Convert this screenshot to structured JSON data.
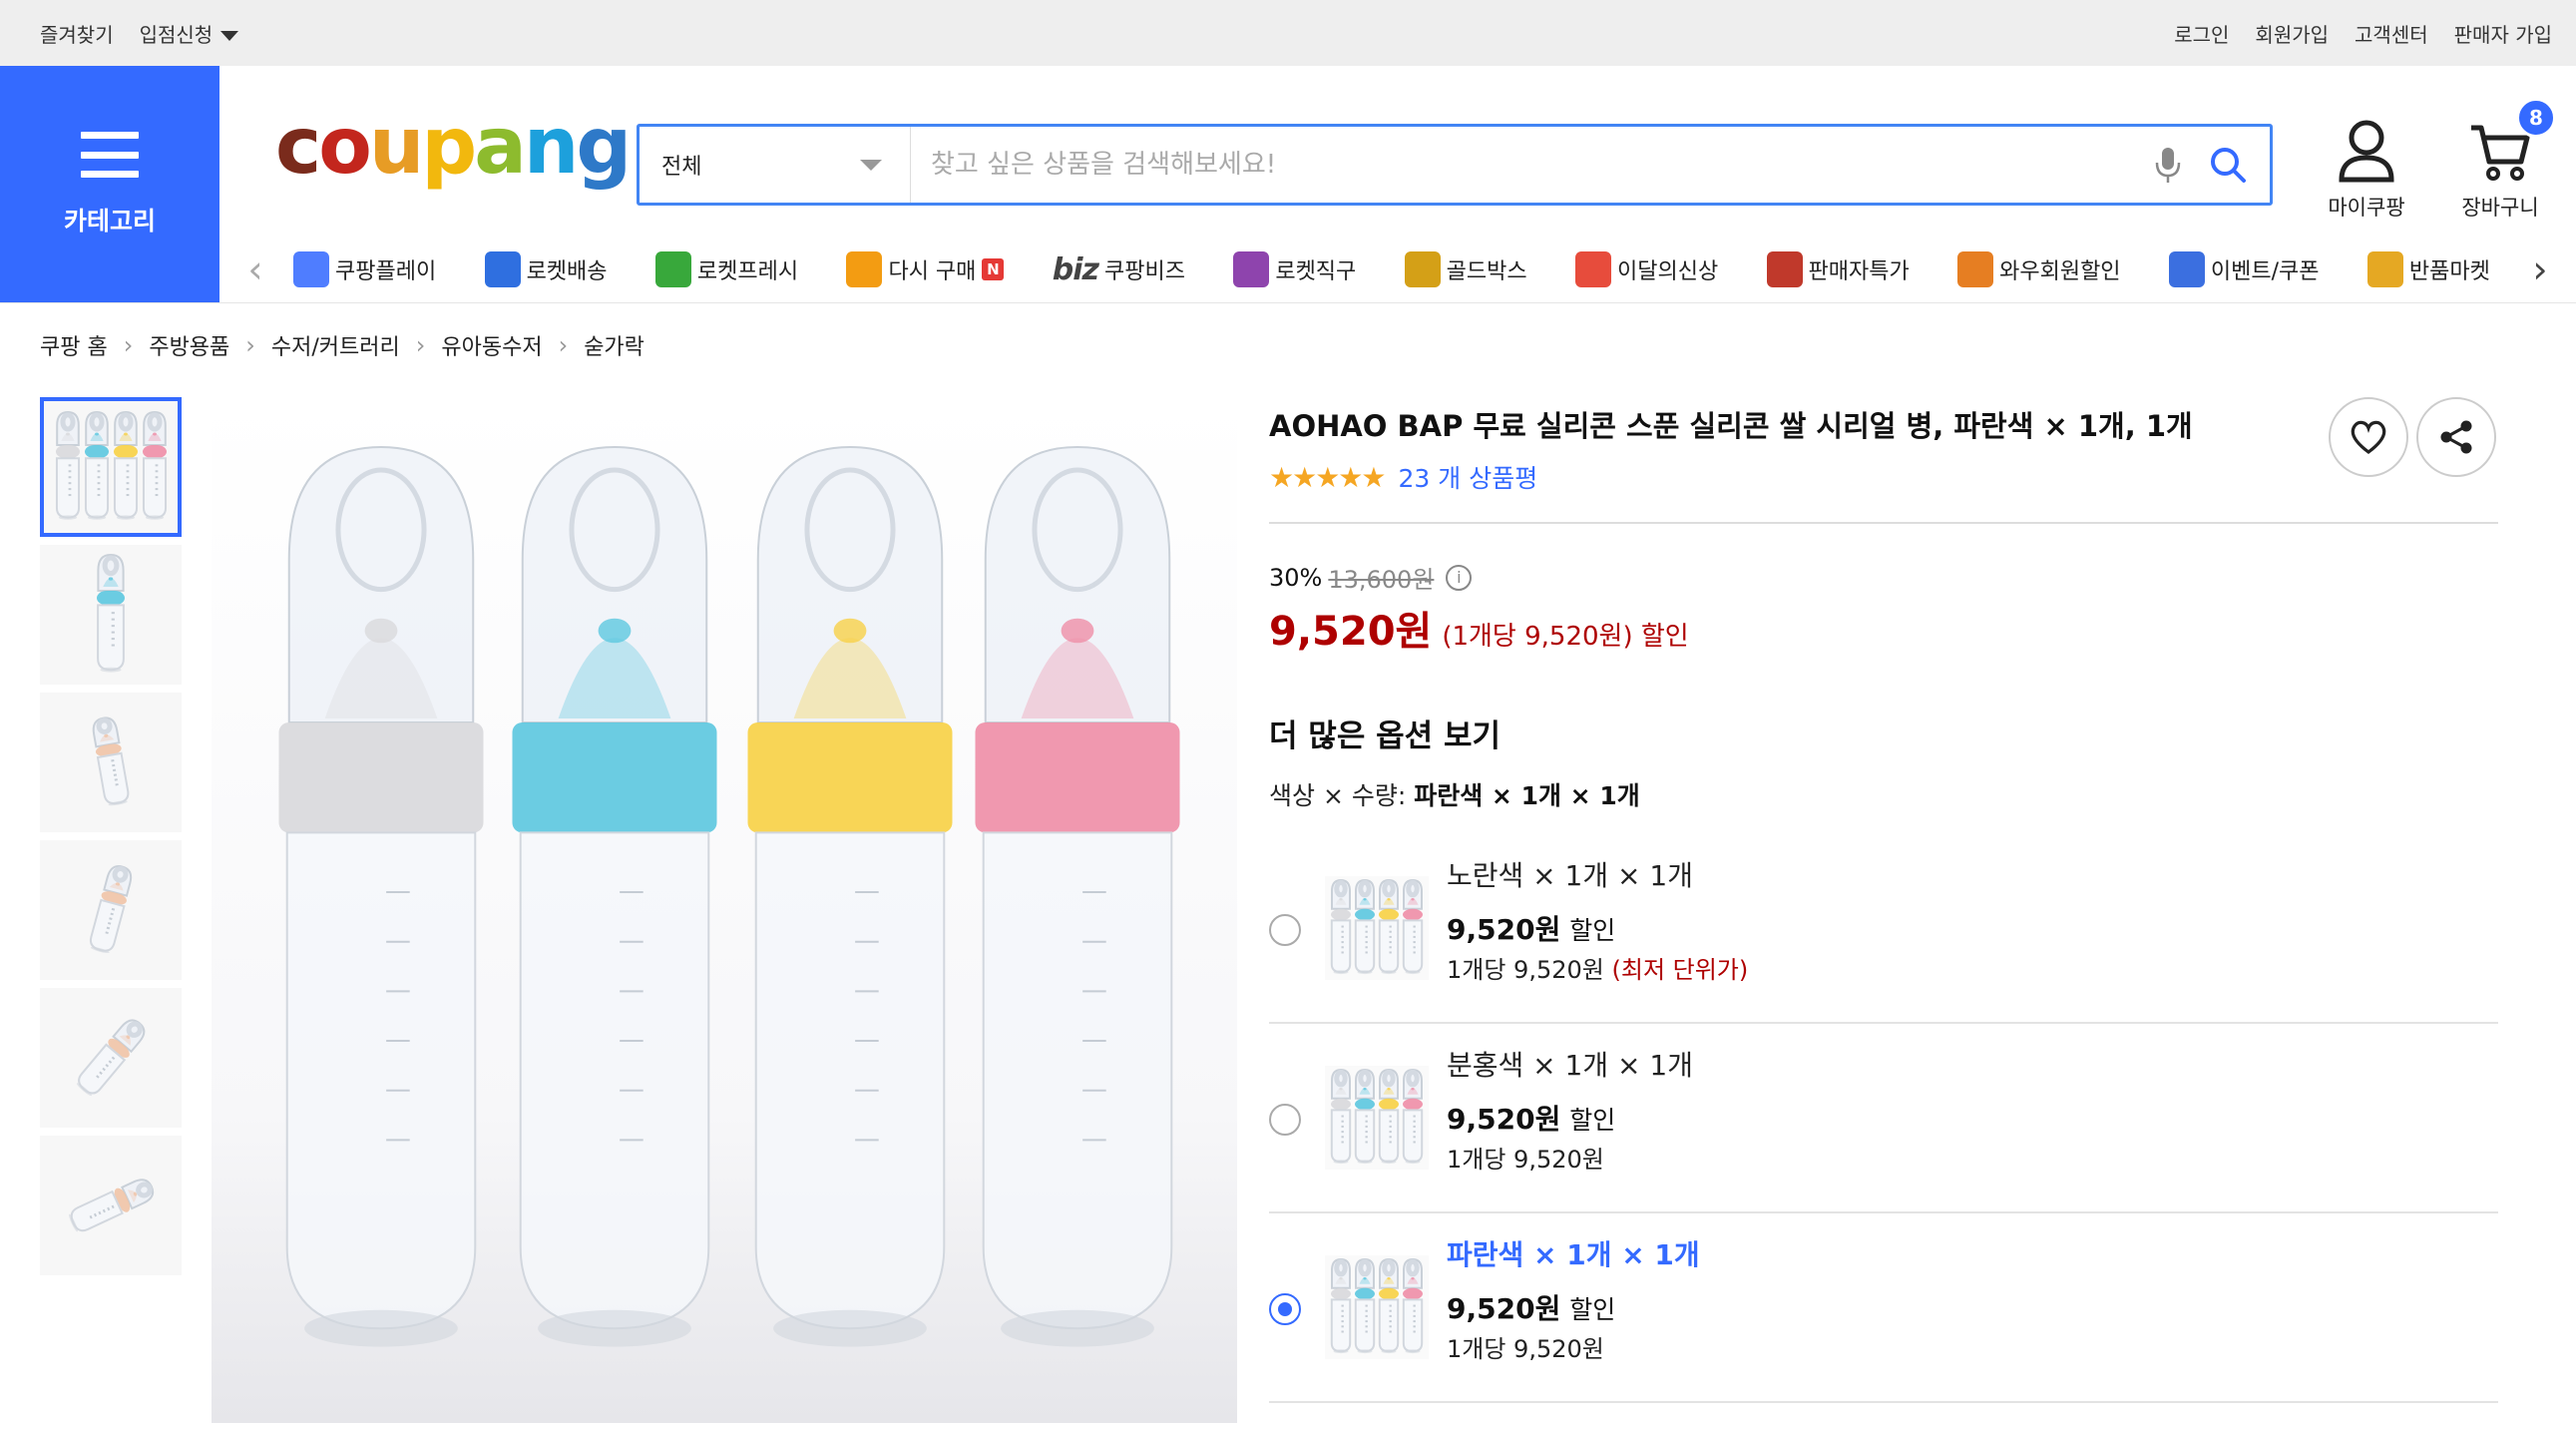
{
  "topbar": {
    "left": [
      "즐겨찾기",
      "입점신청"
    ],
    "right": [
      "로그인",
      "회원가입",
      "고객센터",
      "판매자 가입"
    ]
  },
  "header": {
    "category_label": "카테고리",
    "logo": [
      "c",
      "o",
      "u",
      "p",
      "a",
      "n",
      "g"
    ],
    "logo_colors": [
      "#7a2b1c",
      "#c3261d",
      "#e79c25",
      "#f2b80e",
      "#8dbb2e",
      "#1da0dc",
      "#2e79c8"
    ],
    "search": {
      "category": "전체",
      "placeholder": "찾고 싶은 상품을 검색해보세요!"
    },
    "my_label": "마이쿠팡",
    "cart_label": "장바구니",
    "cart_count": "8"
  },
  "service_nav": [
    {
      "label": "쿠팡플레이",
      "icon": "coupang-play-icon",
      "color": "#4f7dff"
    },
    {
      "label": "로켓배송",
      "icon": "rocket-delivery-icon",
      "color": "#2f6fe0"
    },
    {
      "label": "로켓프레시",
      "icon": "rocket-fresh-icon",
      "color": "#38a83b"
    },
    {
      "label": "다시 구매",
      "icon": "rebuy-icon",
      "color": "#f39c12",
      "badge": "N"
    },
    {
      "label": "쿠팡비즈",
      "icon": "biz-icon",
      "prefix": "biz"
    },
    {
      "label": "로켓직구",
      "icon": "rocket-global-icon",
      "color": "#8e44ad"
    },
    {
      "label": "골드박스",
      "icon": "goldbox-icon",
      "color": "#d4a017"
    },
    {
      "label": "이달의신상",
      "icon": "new-arrivals-icon",
      "color": "#e74c3c"
    },
    {
      "label": "판매자특가",
      "icon": "seller-deal-icon",
      "color": "#c0392b"
    },
    {
      "label": "와우회원할인",
      "icon": "wow-icon",
      "color": "#e67e22"
    },
    {
      "label": "이벤트/쿠폰",
      "icon": "coupon-icon",
      "color": "#3b6fe0"
    },
    {
      "label": "반품마켓",
      "icon": "return-market-icon",
      "color": "#e5a823"
    }
  ],
  "breadcrumb": [
    "쿠팡 홈",
    "주방용품",
    "수저/커트러리",
    "유아동수저",
    "숟가락"
  ],
  "product": {
    "title": "AOHAO BAP 무료 실리콘 스푼 실리콘 쌀 시리얼 병, 파란색 × 1개, 1개",
    "stars": "★★★★★",
    "review_count": "23 개 상품평",
    "discount_rate": "30%",
    "original_price": "13,600원",
    "price": "9,520원",
    "unit_price_text": "(1개당 9,520원) 할인",
    "more_options_title": "더 많은 옵션 보기",
    "option_selection_label": "색상 × 수량:",
    "option_selection_value": "파란색 × 1개 × 1개"
  },
  "options": [
    {
      "name": "노란색 × 1개 × 1개",
      "price": "9,520원",
      "suffix": "할인",
      "unit": "1개당 9,520원",
      "note": "(최저 단위가)",
      "selected": false
    },
    {
      "name": "분홍색 × 1개 × 1개",
      "price": "9,520원",
      "suffix": "할인",
      "unit": "1개당 9,520원",
      "note": "",
      "selected": false
    },
    {
      "name": "파란색 × 1개 × 1개",
      "price": "9,520원",
      "suffix": "할인",
      "unit": "1개당 9,520원",
      "note": "",
      "selected": true
    }
  ],
  "bottle_colors": [
    "#d9d9dc",
    "#5ec8e0",
    "#f7d148",
    "#ef8fa8"
  ]
}
